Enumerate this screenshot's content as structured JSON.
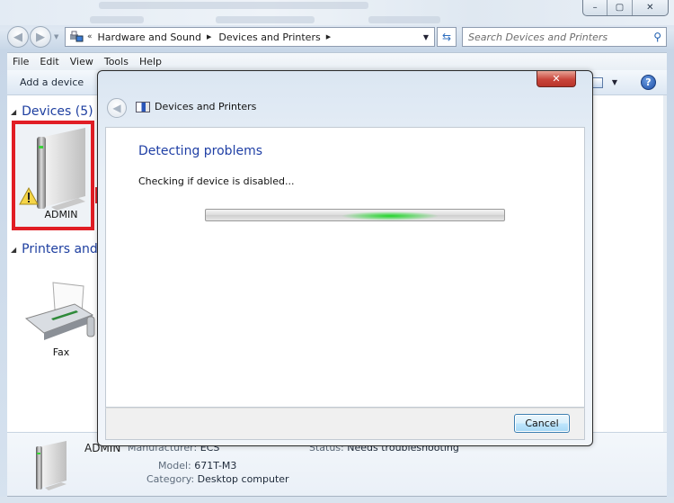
{
  "window": {
    "controls": {
      "minimize": "–",
      "maximize": "▢",
      "close": "✕"
    }
  },
  "navigation": {
    "back_icon": "back-arrow-icon",
    "forward_icon": "forward-arrow-icon",
    "breadcrumb": {
      "prefix": "«",
      "items": [
        "Hardware and Sound",
        "Devices and Printers"
      ]
    },
    "search_placeholder": "Search Devices and Printers"
  },
  "menu": {
    "items": [
      "File",
      "Edit",
      "View",
      "Tools",
      "Help"
    ]
  },
  "toolbar": {
    "add_device_label": "Add a device",
    "help_glyph": "?"
  },
  "groups": [
    {
      "title": "Devices (5)",
      "devices": [
        {
          "name": "ADMIN",
          "warning": true
        }
      ]
    },
    {
      "title": "Printers and F",
      "devices": [
        {
          "name": "Fax"
        }
      ]
    }
  ],
  "details": {
    "device_name": "ADMIN",
    "manufacturer_label": "Manufacturer:",
    "manufacturer_value": "ECS",
    "model_label": "Model:",
    "model_value": "671T-M3",
    "category_label": "Category:",
    "category_value": "Desktop computer",
    "status_label": "Status:",
    "status_value": "Needs troubleshooting"
  },
  "dialog": {
    "title": "Devices and Printers",
    "close_glyph": "✕",
    "heading": "Detecting problems",
    "status_text": "Checking if device is disabled...",
    "progress": {
      "state": "indeterminate",
      "color": "#22d42a"
    },
    "cancel_label": "Cancel"
  },
  "annotation": {
    "highlight_color": "#e11d24"
  }
}
